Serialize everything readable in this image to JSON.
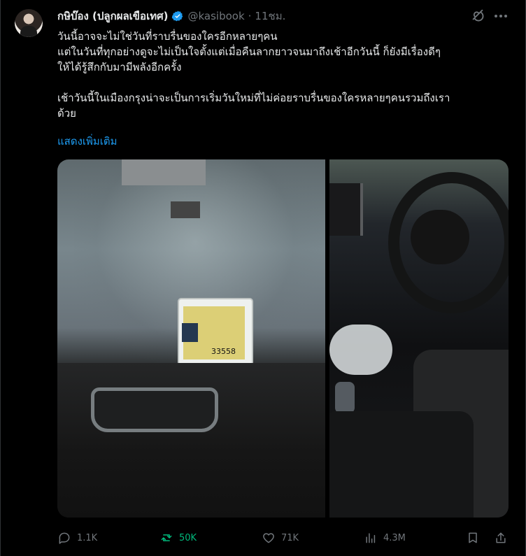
{
  "author": {
    "display_name": "กษิบ๊อง (ปลูกผลเขือเทศ)",
    "handle": "@kasibook",
    "separator": "·",
    "time": "11ชม."
  },
  "tweet": {
    "text_lines": [
      "วันนี้อาจจะไม่ใช่วันที่ราบรื่นของใครอีกหลายๆคน",
      "แต่ในวันที่ทุกอย่างดูจะไม่เป็นใจตั้งแต่เมื่อคืนลากยาวจนมาถึงเช้าอีกวันนี้ ก็ยังมีเรื่องดีๆ",
      "ให้ได้รู้สึกกับมามีพลังอีกครั้ง",
      "",
      "เช้าวันนี้ในเมืองกรุงน่าจะเป็นการเริ่มวันใหม่ที่ไม่ค่อยราบรื่นของใครหลายๆคนรวมถึงเรา",
      "ด้วย"
    ],
    "show_more": "แสดงเพิ่มเติม"
  },
  "media": {
    "photo1_card_number": "33558"
  },
  "actions": {
    "reply_count": "1.1K",
    "repost_count": "50K",
    "like_count": "71K",
    "view_count": "4.3M"
  },
  "icons": {
    "verified": "verified-badge-icon",
    "grok": "grok-icon",
    "more": "more-icon",
    "reply": "reply-icon",
    "repost": "repost-icon",
    "like": "like-icon",
    "views": "views-icon",
    "bookmark": "bookmark-icon",
    "share": "share-icon"
  },
  "colors": {
    "background": "#000000",
    "text": "#e7e9ea",
    "muted": "#71767b",
    "link": "#1d9bf0",
    "repost": "#00ba7c"
  }
}
